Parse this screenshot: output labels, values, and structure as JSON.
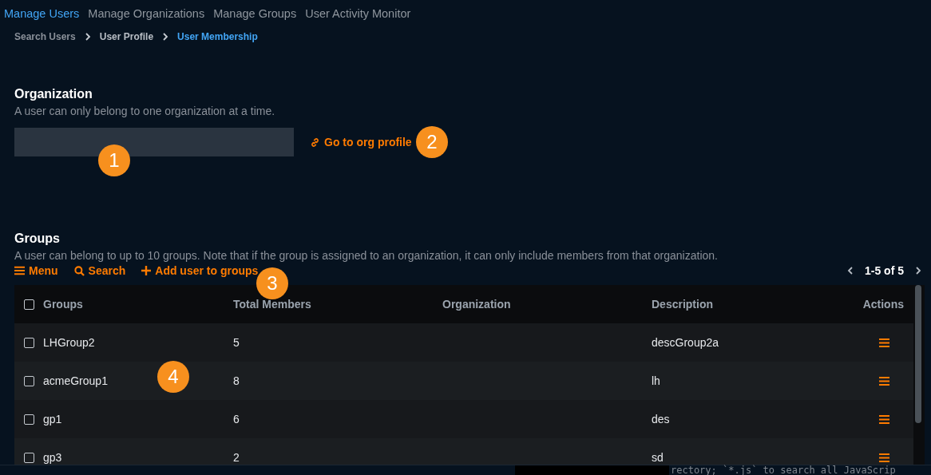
{
  "nav_tabs": [
    {
      "label": "Manage Users",
      "selected": true
    },
    {
      "label": "Manage Organizations",
      "selected": false
    },
    {
      "label": "Manage Groups",
      "selected": false
    },
    {
      "label": "User Activity Monitor",
      "selected": false
    }
  ],
  "breadcrumb": [
    {
      "label": "Search Users",
      "selected": false
    },
    {
      "label": "User Profile",
      "selected": false
    },
    {
      "label": "User Membership",
      "selected": true
    }
  ],
  "organization": {
    "title": "Organization",
    "description": "A user can only belong to one organization at a time.",
    "link": "Go to org profile"
  },
  "groups": {
    "title": "Groups",
    "description": "A user can belong to up to 10 groups. Note that if the group is assigned to an organization, it can only include members from that organization.",
    "toolbar": [
      {
        "kind": "menu",
        "label": "Menu"
      },
      {
        "kind": "search",
        "label": "Search"
      },
      {
        "kind": "add",
        "label": "Add user to groups"
      }
    ],
    "pagination": "1-5 of 5",
    "table": {
      "select_all_checked": false,
      "columns": [
        "Groups",
        "Total Members",
        "Organization",
        "Description",
        "Actions"
      ],
      "rows": [
        {
          "checked": false,
          "name": "LHGroup2",
          "total_members": "5",
          "description": "descGroup2a"
        },
        {
          "checked": false,
          "name": "acmeGroup1",
          "total_members": "8",
          "description": "lh"
        },
        {
          "checked": false,
          "name": "gp1",
          "total_members": "6",
          "description": "des"
        },
        {
          "checked": false,
          "name": "gp3",
          "total_members": "2",
          "description": "sd"
        }
      ]
    }
  },
  "callouts": [
    "1",
    "2",
    "3",
    "4"
  ],
  "status_hint": "rectory; `*.js` to search all JavaScrip"
}
